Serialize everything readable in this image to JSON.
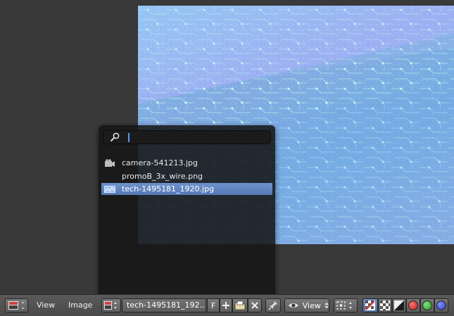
{
  "header": {
    "view_label": "View",
    "image_label": "Image",
    "image_name": "tech-1495181_192...",
    "fake_user_label": "F",
    "mode_label": "View"
  },
  "browse_popup": {
    "search_value": "",
    "items": [
      {
        "label": "camera-541213.jpg",
        "icon": "camera-icon",
        "selected": false
      },
      {
        "label": "promoB_3x_wire.png",
        "icon": "",
        "selected": false
      },
      {
        "label": "tech-1495181_1920.jpg",
        "icon": "image-icon",
        "selected": true
      }
    ]
  },
  "colors": {
    "background": "#393939",
    "header": "#4f4f4f",
    "selection": "#5d80bb",
    "channel_red": "#b82020",
    "channel_green": "#2a9a2a",
    "channel_blue": "#2a3ab8"
  }
}
